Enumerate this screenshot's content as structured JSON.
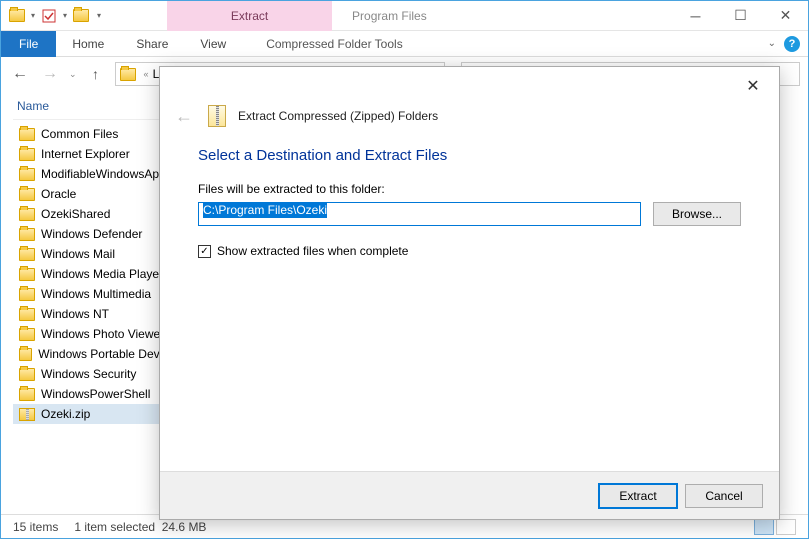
{
  "window": {
    "context_tab_group": "Extract",
    "title": "Program Files"
  },
  "ribbon": {
    "file": "File",
    "tabs": [
      "Home",
      "Share",
      "View"
    ],
    "context_tab": "Compressed Folder Tools"
  },
  "address": {
    "crumb_partial": "Lo"
  },
  "columns": {
    "name": "Name"
  },
  "files": [
    "Common Files",
    "Internet Explorer",
    "ModifiableWindowsApps",
    "Oracle",
    "OzekiShared",
    "Windows Defender",
    "Windows Mail",
    "Windows Media Player",
    "Windows Multimedia",
    "Windows NT",
    "Windows Photo Viewer",
    "Windows Portable Devices",
    "Windows Security",
    "WindowsPowerShell"
  ],
  "selected_file": "Ozeki.zip",
  "status": {
    "count": "15 items",
    "selection": "1 item selected",
    "size": "24.6 MB"
  },
  "dialog": {
    "title": "Extract Compressed (Zipped) Folders",
    "heading": "Select a Destination and Extract Files",
    "label": "Files will be extracted to this folder:",
    "path": "C:\\Program Files\\Ozeki",
    "browse": "Browse...",
    "checkbox_label": "Show extracted files when complete",
    "checkbox_checked": true,
    "extract": "Extract",
    "cancel": "Cancel"
  }
}
